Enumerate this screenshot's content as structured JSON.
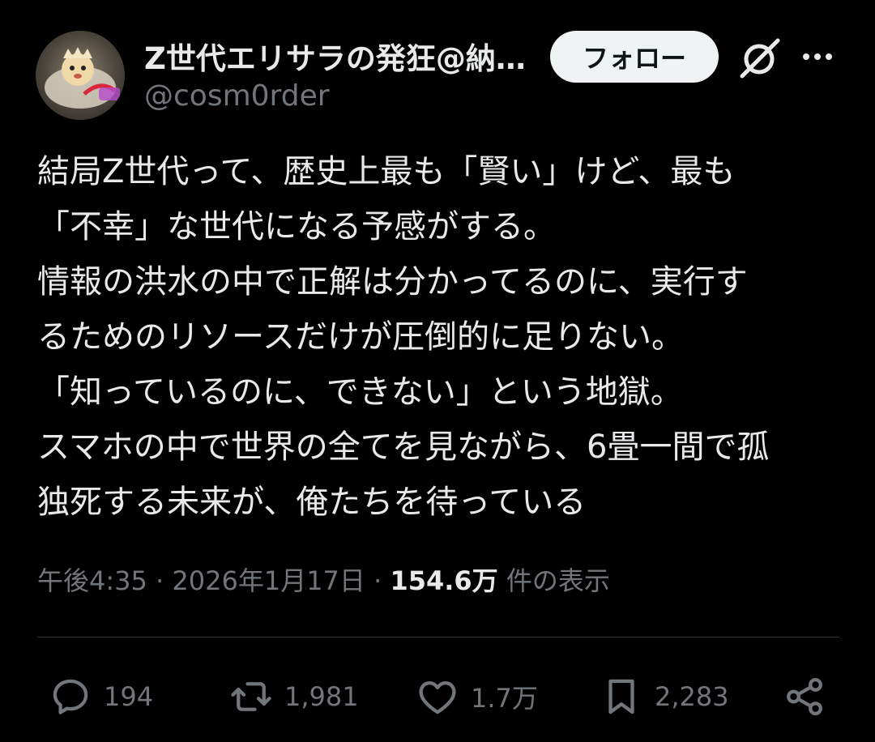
{
  "author": {
    "display_name": "Z世代エリサラの発狂@納…",
    "handle": "@cosm0rder"
  },
  "buttons": {
    "follow_label": "フォロー"
  },
  "icons": {
    "grok": "grok-icon",
    "more": "more-icon",
    "reply": "reply-icon",
    "repost": "repost-icon",
    "like": "like-icon",
    "bookmark": "bookmark-icon",
    "share": "share-icon"
  },
  "tweet": {
    "lines": [
      "結局Z世代って、歴史上最も「賢い」けど、最も",
      "「不幸」な世代になる予感がする。",
      "情報の洪水の中で正解は分かってるのに、実行す",
      "るためのリソースだけが圧倒的に足りない。",
      "「知っているのに、できない」という地獄。",
      "スマホの中で世界の全てを見ながら、6畳一間で孤",
      "独死する未来が、俺たちを待っている"
    ]
  },
  "meta": {
    "time": "午後4:35",
    "separator1": "·",
    "date": "2026年1月17日",
    "separator2": "·",
    "views_count": "154.6万",
    "views_label": "件の表示"
  },
  "stats": {
    "replies": "194",
    "reposts": "1,981",
    "likes": "1.7万",
    "bookmarks": "2,283"
  },
  "colors": {
    "background": "#000000",
    "text": "#e7e9ea",
    "secondary": "#71767b",
    "follow_bg": "#eff3f4",
    "divider": "#2f3336"
  }
}
